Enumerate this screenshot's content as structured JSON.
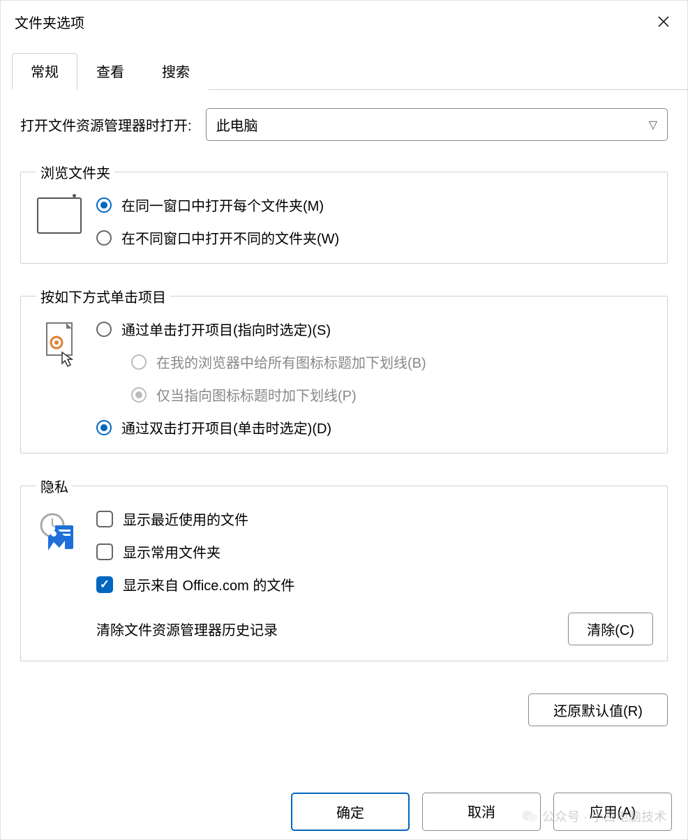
{
  "window": {
    "title": "文件夹选项"
  },
  "tabs": {
    "general": "常规",
    "view": "查看",
    "search": "搜索"
  },
  "open_with": {
    "label": "打开文件资源管理器时打开:",
    "value": "此电脑"
  },
  "browse": {
    "legend": "浏览文件夹",
    "same_window": "在同一窗口中打开每个文件夹(M)",
    "new_window": "在不同窗口中打开不同的文件夹(W)"
  },
  "click": {
    "legend": "按如下方式单击项目",
    "single": "通过单击打开项目(指向时选定)(S)",
    "underline_all": "在我的浏览器中给所有图标标题加下划线(B)",
    "underline_point": "仅当指向图标标题时加下划线(P)",
    "double": "通过双击打开项目(单击时选定)(D)"
  },
  "privacy": {
    "legend": "隐私",
    "show_recent": "显示最近使用的文件",
    "show_freq": "显示常用文件夹",
    "show_office": "显示来自 Office.com 的文件",
    "clear_label": "清除文件资源管理器历史记录",
    "clear_btn": "清除(C)"
  },
  "restore": "还原默认值(R)",
  "footer": {
    "ok": "确定",
    "cancel": "取消",
    "apply": "应用(A)"
  },
  "watermark": "公众号 · 小白电脑技术"
}
